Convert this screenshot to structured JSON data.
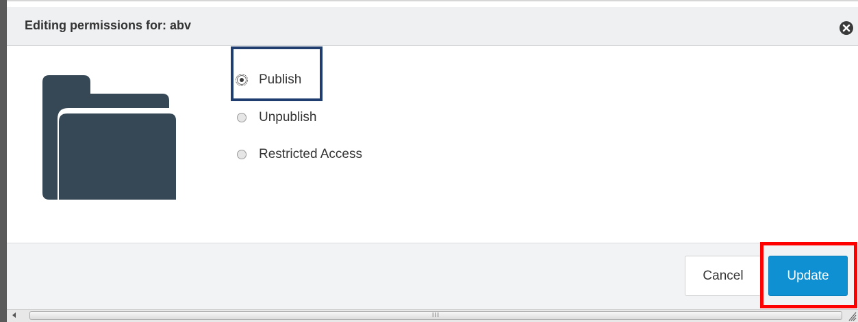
{
  "dialog": {
    "title": "Editing permissions for: abv",
    "close_icon": "close-circle-icon"
  },
  "permissions": {
    "options": [
      {
        "label": "Publish",
        "checked": true
      },
      {
        "label": "Unpublish",
        "checked": false
      },
      {
        "label": "Restricted Access",
        "checked": false
      }
    ]
  },
  "folder_icon": "folder-icon",
  "footer": {
    "cancel_label": "Cancel",
    "update_label": "Update"
  },
  "scrollbar": {
    "grip_text": "III"
  },
  "colors": {
    "primary_button": "#0e90d2",
    "folder": "#364756",
    "highlight_blue": "#1f3d6e",
    "highlight_red": "#ff0000"
  }
}
